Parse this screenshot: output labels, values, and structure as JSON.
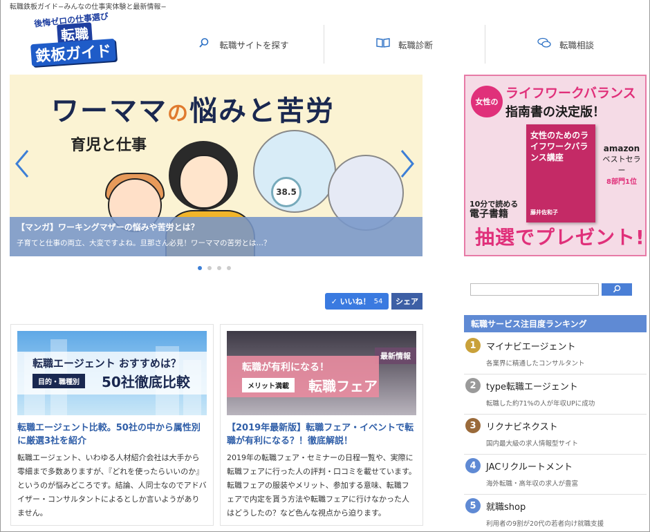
{
  "site": {
    "tagline": "転職鉄板ガイド−みんなの仕事実体験と最新情報−",
    "logo": {
      "top": "後悔ゼロの仕事選び",
      "mid": "転職",
      "bottom": "鉄板ガイド"
    }
  },
  "nav": [
    {
      "label": "転職サイトを探す",
      "icon": "search-icon",
      "glyph": "⚲"
    },
    {
      "label": "転職診断",
      "icon": "book-icon",
      "glyph": "📖"
    },
    {
      "label": "転職相談",
      "icon": "chat-icon",
      "glyph": "💬"
    }
  ],
  "slider": {
    "title_a": "ワーママ",
    "title_no": "の",
    "title_b": "悩みと苦労",
    "subtitle": "育児と仕事",
    "thermometer": "38.5",
    "caption_title": "【マンガ】ワーキングマザーの悩みや苦労とは？",
    "caption_text": "子育てと仕事の両立、大変ですよね。旦那さん必見！ワーママの苦労とは…？",
    "prev": "〈",
    "next": "〉"
  },
  "social": {
    "like_label": "✓ いいね！",
    "like_count": "54",
    "share_label": "シェア"
  },
  "articles": [
    {
      "thumb_main": "転職エージェント おすすめは？",
      "thumb_chip": "目的・職種別",
      "thumb_big": "50社徹底比較",
      "title": "転職エージェント比較。50社の中から属性別に厳選3社を紹介",
      "text": "転職エージェント、いわゆる人材紹介会社は大手から零細まで多数ありますが、『どれを使ったらいいのか』というのが悩みどころです。結論、人同士なのでアドバイザー・コンサルタントによるとしか言いようがありません。"
    },
    {
      "thumb_badge": "最新情報",
      "thumb_main": "転職が有利になる！",
      "thumb_chip": "メリット満載",
      "thumb_big": "転職フェア",
      "title": "【2019年最新版】転職フェア・イベントで転職が有利になる？！徹底解説！",
      "text": "2019年の転職フェア・セミナーの日程一覧や、実際に転職フェアに行った人の評判・口コミを載せています。転職フェアの服装やメリット、参加する意味、転職フェアで内定を貰う方法や転職フェアに行けなかった人はどうしたの？など色んな視点から迫ります。"
    }
  ],
  "ad": {
    "badge": "女性の",
    "line1": "ライフワークバランス",
    "line2": "指南書の決定版！",
    "book_title": "女性のためのライフワークバランス講座",
    "book_author": "藤井佐和子",
    "amazon": "amazon",
    "amazon_sub": "ベストセラー",
    "amazon_rank": "8部門1位",
    "ebook_1": "10分で読める",
    "ebook_2": "電子書籍",
    "bottom": "抽選でプレゼント!"
  },
  "search": {
    "placeholder": "",
    "button_glyph": "⚲"
  },
  "ranking": {
    "heading": "転職サービス注目度ランキング",
    "items": [
      {
        "num": "1",
        "name": "マイナビエージェント",
        "desc": "各業界に精通したコンサルタント",
        "color": "#c9a13a"
      },
      {
        "num": "2",
        "name": "type転職エージェント",
        "desc": "転職した約71%の人が年収UPに成功",
        "color": "#9a9a9a"
      },
      {
        "num": "3",
        "name": "リクナビネクスト",
        "desc": "国内最大級の求人情報型サイト",
        "color": "#9a6a3a"
      },
      {
        "num": "4",
        "name": "JACリクルートメント",
        "desc": "海外転職・高年収の求人が豊富",
        "color": "#5f8ad4"
      },
      {
        "num": "5",
        "name": "就職shop",
        "desc": "利用者の9割が20代の若者向け就職支援",
        "color": "#5f8ad4"
      }
    ]
  }
}
